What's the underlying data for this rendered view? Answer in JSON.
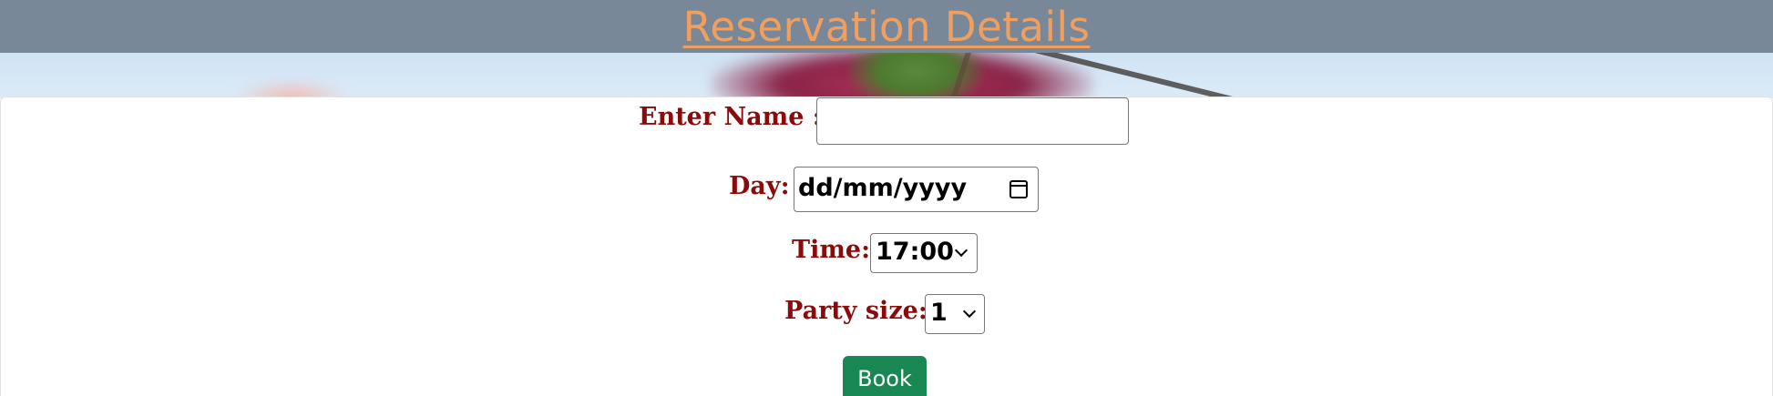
{
  "header": {
    "title": "Reservation Details",
    "title_color": "#f0a05e",
    "background_color": "#798899"
  },
  "form": {
    "name": {
      "label": "Enter Name :",
      "value": ""
    },
    "day": {
      "label": "Day:",
      "value": "dd/mm/yyyy",
      "icon": "calendar-icon"
    },
    "time": {
      "label": "Time:",
      "selected": "17:00",
      "icon": "chevron-down-icon"
    },
    "party_size": {
      "label": "Party size:",
      "selected": "1",
      "icon": "chevron-down-icon"
    },
    "label_color": "#8b0a0a",
    "submit": {
      "label": "Book",
      "color": "#198754"
    }
  }
}
